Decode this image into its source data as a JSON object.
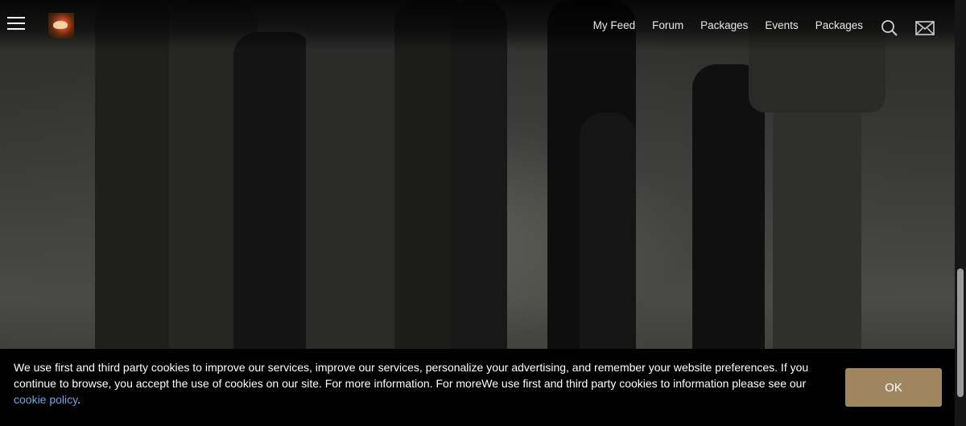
{
  "nav": {
    "items": [
      "My Feed",
      "Forum",
      "Packages",
      "Events",
      "Packages"
    ]
  },
  "icons": {
    "menu": "hamburger-icon",
    "logo": "site-logo",
    "search": "search-icon",
    "mail": "mail-icon"
  },
  "cookie_banner": {
    "text": "We use first and third party cookies to improve our services, improve our services, personalize your advertising, and remember your website preferences. If you continue to browse, you accept the use of cookies on our site. For more information. For moreWe use first and third party cookies to information please see our ",
    "link_text": "cookie policy",
    "after_link": ".",
    "ok_label": "OK"
  },
  "colors": {
    "ok_button": "#9f8660",
    "link": "#6aa7e8",
    "banner_bg": "#000000"
  }
}
